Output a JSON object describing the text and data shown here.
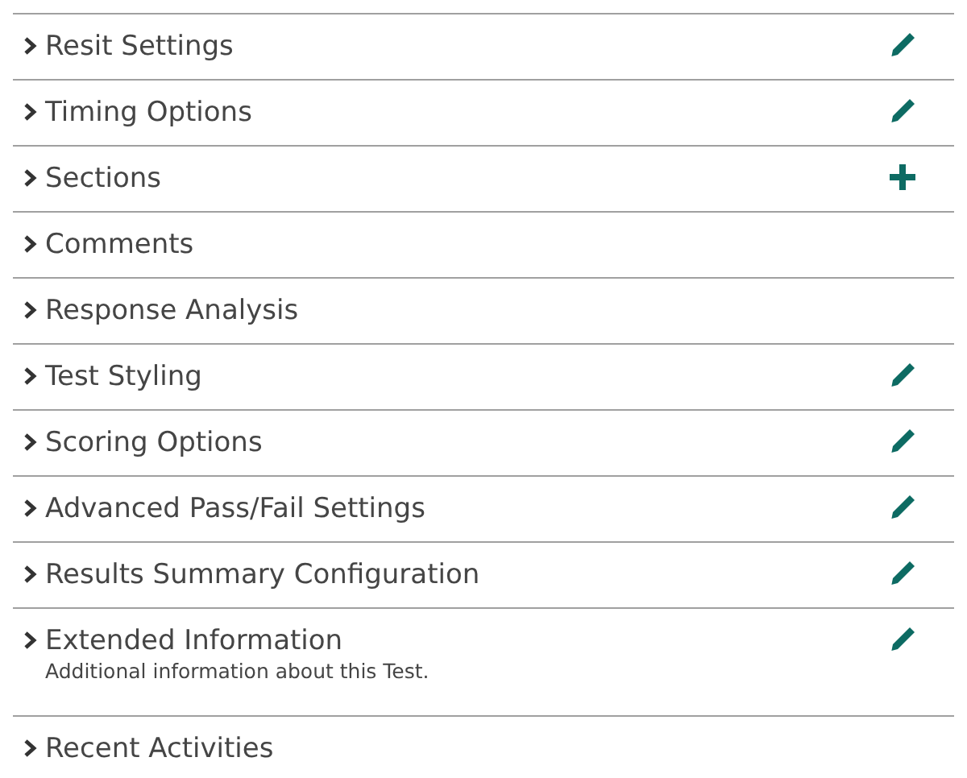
{
  "sections": [
    {
      "title": "Resit Settings",
      "kind": "edit"
    },
    {
      "title": "Timing Options",
      "kind": "edit"
    },
    {
      "title": "Sections",
      "kind": "add"
    },
    {
      "title": "Comments",
      "kind": "plain"
    },
    {
      "title": "Response Analysis",
      "kind": "plain"
    },
    {
      "title": "Test Styling",
      "kind": "edit"
    },
    {
      "title": "Scoring Options",
      "kind": "edit"
    },
    {
      "title": "Advanced Pass/Fail Settings",
      "kind": "edit"
    },
    {
      "title": "Results Summary Configuration",
      "kind": "edit"
    },
    {
      "title": "Extended Information",
      "description": "Additional information about this Test.",
      "kind": "edit"
    },
    {
      "title": "Recent Activities",
      "kind": "plain"
    }
  ]
}
